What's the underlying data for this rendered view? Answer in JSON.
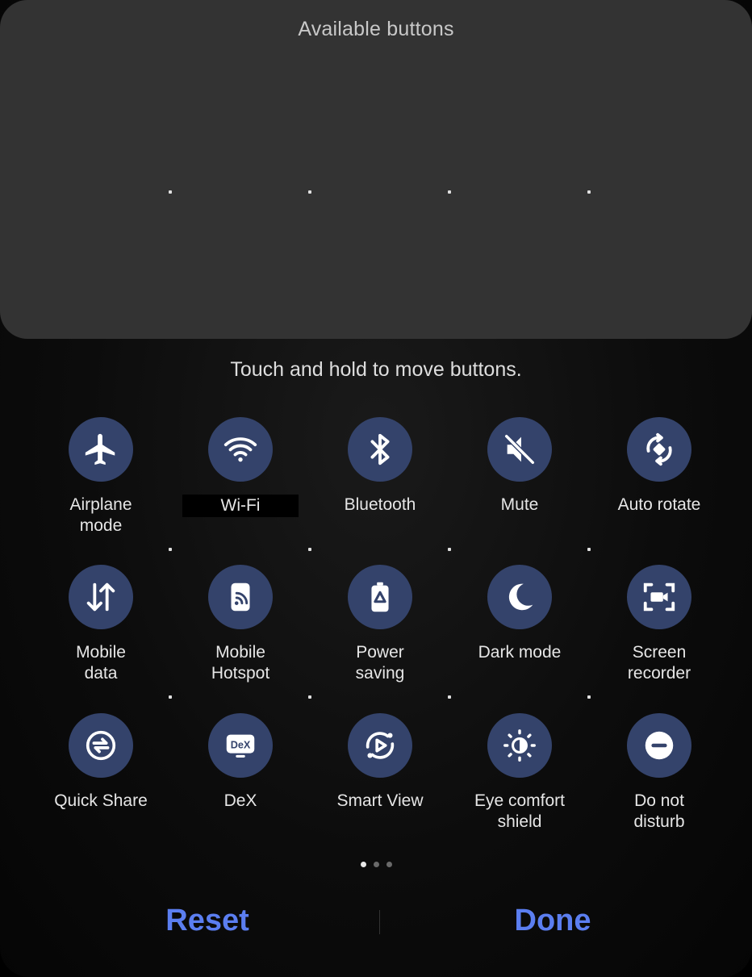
{
  "available_panel": {
    "title": "Available buttons"
  },
  "hint": "Touch and hold to move buttons.",
  "tiles": [
    {
      "label": "Airplane\nmode",
      "icon": "airplane-icon"
    },
    {
      "label": "Wi-Fi",
      "icon": "wifi-icon"
    },
    {
      "label": "Bluetooth",
      "icon": "bluetooth-icon"
    },
    {
      "label": "Mute",
      "icon": "mute-icon"
    },
    {
      "label": "Auto rotate",
      "icon": "auto-rotate-icon"
    },
    {
      "label": "Mobile\ndata",
      "icon": "mobile-data-icon"
    },
    {
      "label": "Mobile\nHotspot",
      "icon": "hotspot-icon"
    },
    {
      "label": "Power\nsaving",
      "icon": "power-saving-icon"
    },
    {
      "label": "Dark mode",
      "icon": "dark-mode-icon"
    },
    {
      "label": "Screen\nrecorder",
      "icon": "screen-recorder-icon"
    },
    {
      "label": "Quick Share",
      "icon": "quick-share-icon"
    },
    {
      "label": "DeX",
      "icon": "dex-icon"
    },
    {
      "label": "Smart View",
      "icon": "smart-view-icon"
    },
    {
      "label": "Eye comfort\nshield",
      "icon": "eye-comfort-icon"
    },
    {
      "label": "Do not\ndisturb",
      "icon": "do-not-disturb-icon"
    }
  ],
  "dex_badge": "DeX",
  "pager": {
    "pages": 3,
    "current": 1
  },
  "actions": {
    "reset": "Reset",
    "done": "Done"
  },
  "colors": {
    "accent": "#5b7ef0",
    "tile_bg": "#34436b",
    "panel_bg": "#333333"
  }
}
